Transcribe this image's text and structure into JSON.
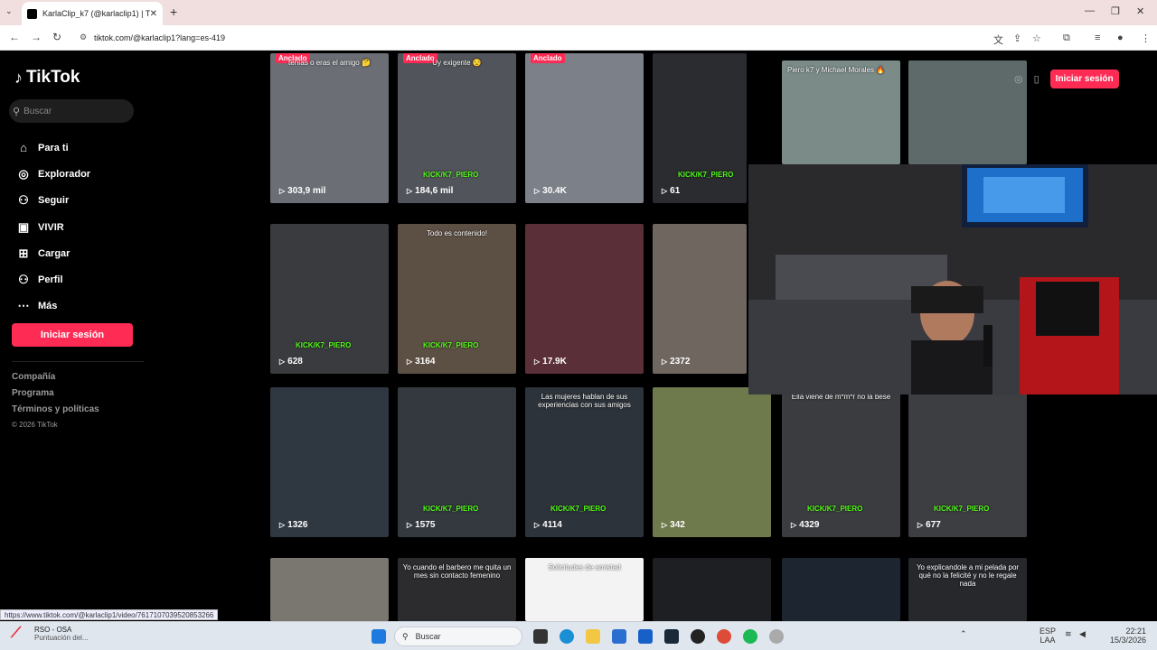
{
  "browser": {
    "tab_title": "KarlaClip_k7 (@karlaclip1) | TikT",
    "url": "tiktok.com/@karlaclip1?lang=es-419",
    "status_url": "https://www.tiktok.com/@karlaclip1/video/7617107039520853266"
  },
  "sidebar": {
    "logo": "TikTok",
    "search_placeholder": "Buscar",
    "items": [
      {
        "label": "Para ti",
        "icon": "home-icon",
        "glyph": "⌂"
      },
      {
        "label": "Explorador",
        "icon": "compass-icon",
        "glyph": "◎"
      },
      {
        "label": "Seguir",
        "icon": "user-follow-icon",
        "glyph": "⚇"
      },
      {
        "label": "VIVIR",
        "icon": "live-icon",
        "glyph": "▣"
      },
      {
        "label": "Cargar",
        "icon": "upload-icon",
        "glyph": "⊞"
      },
      {
        "label": "Perfil",
        "icon": "profile-icon",
        "glyph": "⚇"
      },
      {
        "label": "Más",
        "icon": "more-icon",
        "glyph": "⋯"
      }
    ],
    "login": "Iniciar sesión",
    "footer": [
      "Compañía",
      "Programa",
      "Términos y políticas"
    ],
    "copyright": "© 2026 TikTok"
  },
  "header": {
    "login": "Iniciar sesión"
  },
  "videos": [
    {
      "views": "303,9 mil",
      "pinned": "Anclado",
      "caption": "tenías o eras el amigo 🤔",
      "kick": "",
      "bg": "#6b6f75"
    },
    {
      "views": "184,6 mil",
      "pinned": "Anclado",
      "caption": "Uy exigente 😒",
      "kick": "KICK/K7_PIERO",
      "bg": "#51545a"
    },
    {
      "views": "30.4K",
      "pinned": "Anclado",
      "caption": "",
      "kick": "",
      "bg": "#7c8088"
    },
    {
      "views": "61",
      "pinned": "",
      "caption": "",
      "kick": "KICK/K7_PIERO",
      "bg": "#2a2c30"
    },
    {
      "views": "628",
      "pinned": "",
      "caption": "",
      "kick": "KICK/K7_PIERO",
      "bg": "#3a3b3e"
    },
    {
      "views": "3164",
      "pinned": "",
      "caption": "Todo es contenido!",
      "kick": "KICK/K7_PIERO",
      "bg": "#5c4f44"
    },
    {
      "views": "17.9K",
      "pinned": "",
      "caption": "",
      "kick": "",
      "bg": "#5a2f38"
    },
    {
      "views": "2372",
      "pinned": "",
      "caption": "",
      "kick": "",
      "bg": "#6f6660"
    },
    {
      "views": "1326",
      "pinned": "",
      "caption": "",
      "kick": "",
      "bg": "#2f3740"
    },
    {
      "views": "1575",
      "pinned": "",
      "caption": "",
      "kick": "KICK/K7_PIERO",
      "bg": "#34393f"
    },
    {
      "views": "4114",
      "pinned": "",
      "caption": "Las mujeres hablan de sus experiencias con sus amigos",
      "kick": "KICK/K7_PIERO",
      "bg": "#2d333a"
    },
    {
      "views": "342",
      "pinned": "",
      "caption": "",
      "kick": "",
      "bg": "#6e7a4c"
    },
    {
      "views": "4329",
      "pinned": "",
      "caption": "Ella viene de m*m*r no la bese",
      "kick": "KICK/K7_PIERO",
      "bg": "#3b3c3f"
    },
    {
      "views": "677",
      "pinned": "",
      "caption": "",
      "kick": "KICK/K7_PIERO",
      "bg": "#3d3e42"
    },
    {
      "views": "",
      "pinned": "",
      "caption": "",
      "kick": "",
      "bg": "#7a7670"
    },
    {
      "views": "",
      "pinned": "",
      "caption": "Yo cuando el barbero me quita un mes sin contacto femenino",
      "kick": "",
      "bg": "#2c2c2e"
    },
    {
      "views": "",
      "pinned": "",
      "caption": "Solicitudes de amistad",
      "kick": "",
      "bg": "#f3f3f3"
    },
    {
      "views": "",
      "pinned": "",
      "caption": "",
      "kick": "",
      "bg": "#1e1f22"
    },
    {
      "views": "",
      "pinned": "",
      "caption": "",
      "kick": "",
      "bg": "#1c2530"
    },
    {
      "views": "",
      "pinned": "",
      "caption": "Yo explicandole a mi pelada por qué no la felicité y no le regale nada",
      "kick": "",
      "bg": "#26282c"
    }
  ],
  "extra_thumbs": [
    {
      "caption": "Piero k7 y Michael Morales 🔥",
      "bg": "#7b8b88"
    },
    {
      "caption": "",
      "bg": "#5e6a6a"
    }
  ],
  "taskbar": {
    "app_title": "RSO - OSA",
    "app_subtitle": "Puntuación del...",
    "search": "Buscar",
    "lang_top": "ESP",
    "lang_bottom": "LAA",
    "time": "22:21",
    "date": "15/3/2026"
  }
}
